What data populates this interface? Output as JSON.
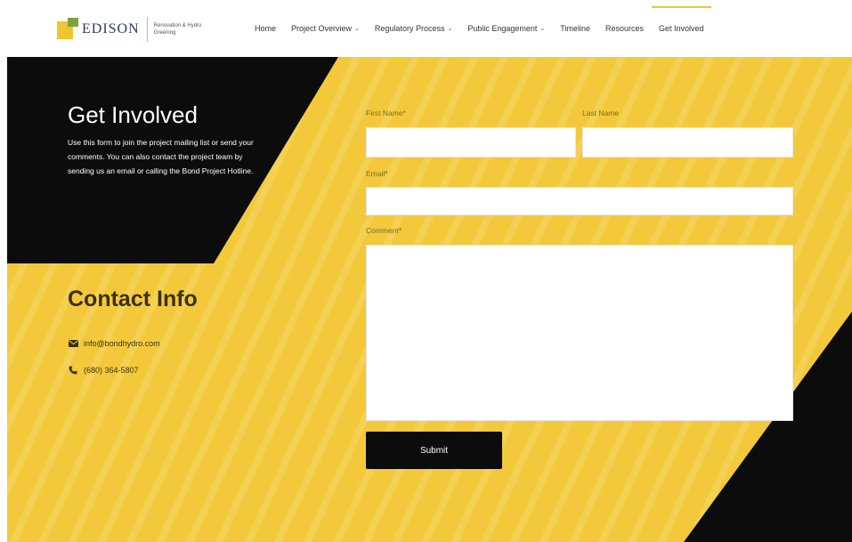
{
  "logo": {
    "wordmark": "EDISON",
    "subtitle": "Renovation & Hydro Greening"
  },
  "nav": [
    {
      "label": "Home",
      "has_dropdown": false,
      "active": false
    },
    {
      "label": "Project Overview",
      "has_dropdown": true,
      "active": false
    },
    {
      "label": "Regulatory Process",
      "has_dropdown": true,
      "active": false
    },
    {
      "label": "Public Engagement",
      "has_dropdown": true,
      "active": false
    },
    {
      "label": "Timeline",
      "has_dropdown": false,
      "active": false
    },
    {
      "label": "Resources",
      "has_dropdown": false,
      "active": false
    },
    {
      "label": "Get Involved",
      "has_dropdown": false,
      "active": true
    }
  ],
  "hero": {
    "title": "Get Involved",
    "intro": "Use this form to join the project mailing list or send your comments. You can also contact the project team by sending us an email or calling the Bond Project Hotline."
  },
  "contact": {
    "title": "Contact Info",
    "email": "info@bondhydro.com",
    "phone": "(680) 364-5807"
  },
  "form": {
    "first_name_label": "First Name*",
    "last_name_label": "Last Name",
    "email_label": "Email*",
    "comment_label": "Comment*",
    "first_name_value": "",
    "last_name_value": "",
    "email_value": "",
    "comment_value": "",
    "submit_label": "Submit"
  },
  "colors": {
    "accent_yellow": "#f3c93b",
    "dark": "#0c0c0c",
    "white": "#ffffff"
  }
}
